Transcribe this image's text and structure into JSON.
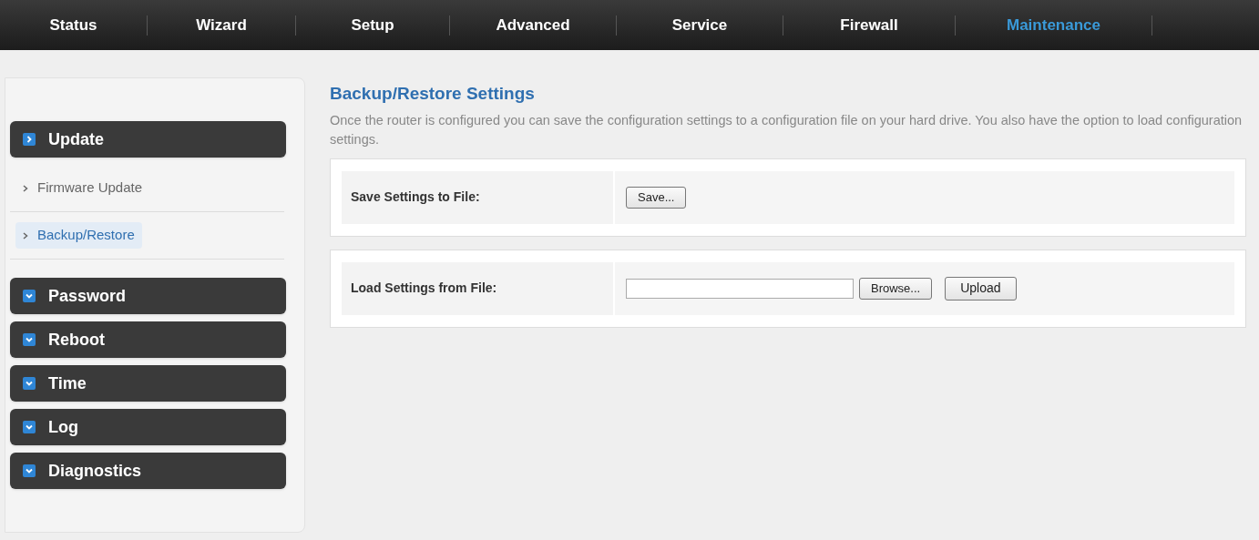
{
  "nav_tabs": [
    {
      "label": "Status",
      "selected": false
    },
    {
      "label": "Wizard",
      "selected": false
    },
    {
      "label": "Setup",
      "selected": false
    },
    {
      "label": "Advanced",
      "selected": false
    },
    {
      "label": "Service",
      "selected": false
    },
    {
      "label": "Firewall",
      "selected": false
    },
    {
      "label": "Maintenance",
      "selected": true
    }
  ],
  "sidebar": {
    "groups": [
      {
        "label": "Update",
        "expanded": true,
        "children": [
          {
            "label": "Firmware Update",
            "selected": false
          },
          {
            "label": "Backup/Restore",
            "selected": true
          }
        ]
      },
      {
        "label": "Password",
        "expanded": false
      },
      {
        "label": "Reboot",
        "expanded": false
      },
      {
        "label": "Time",
        "expanded": false
      },
      {
        "label": "Log",
        "expanded": false
      },
      {
        "label": "Diagnostics",
        "expanded": false
      }
    ]
  },
  "content": {
    "title": "Backup/Restore Settings",
    "description": "Once the router is configured you can save the configuration settings to a configuration file on your hard drive. You also have the option to load configuration settings.",
    "rows": [
      {
        "kind": "save",
        "label": "Save Settings to File:",
        "buttons": [
          "Save..."
        ]
      },
      {
        "kind": "load",
        "label": "Load Settings from File:",
        "buttons": [
          "Browse...",
          "Upload"
        ]
      }
    ]
  }
}
